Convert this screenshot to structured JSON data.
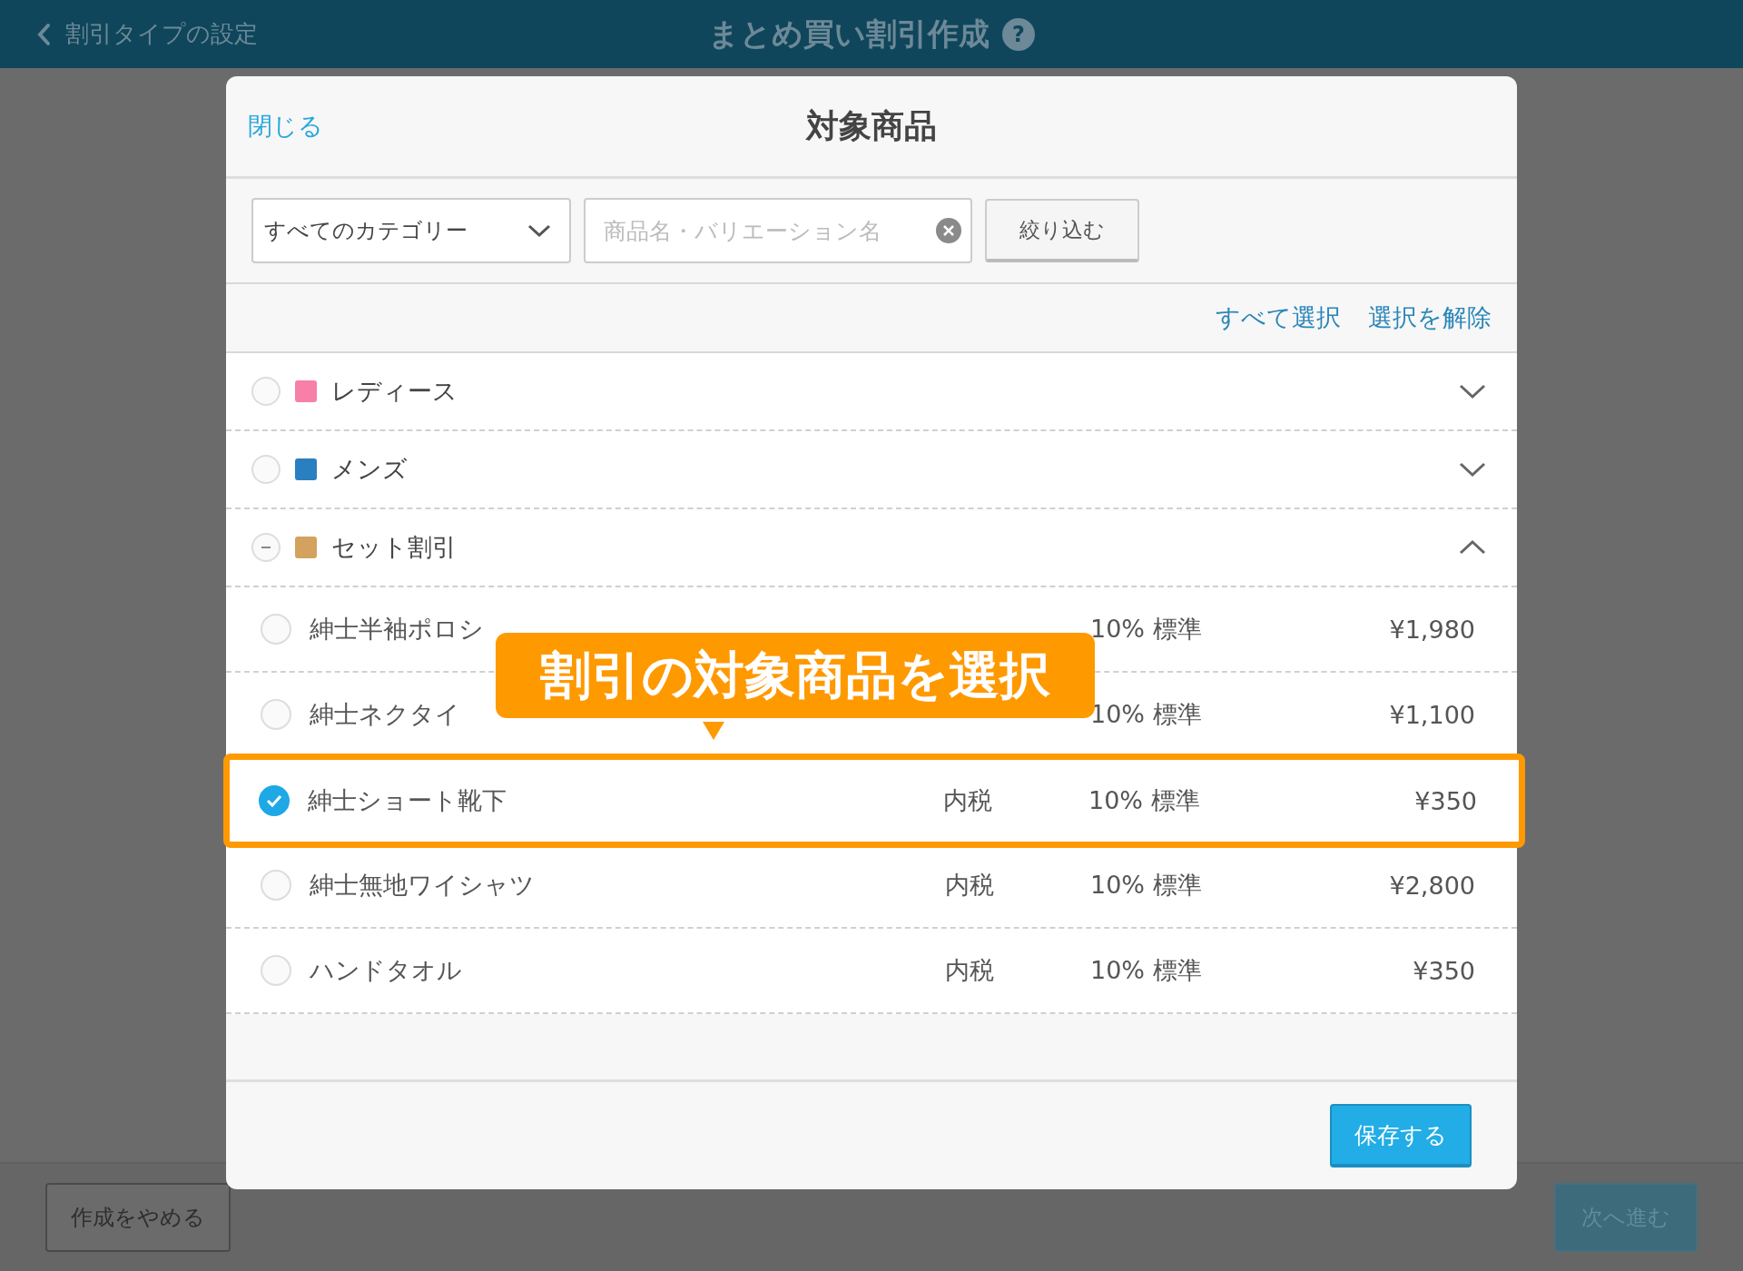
{
  "top_bar": {
    "back_label": "割引タイプの設定",
    "title": "まとめ買い割引作成",
    "help": "?"
  },
  "modal": {
    "close": "閉じる",
    "title": "対象商品",
    "filter": {
      "category": "すべてのカテゴリー",
      "search_placeholder": "商品名・バリエーション名",
      "apply": "絞り込む"
    },
    "select_all": "すべて選択",
    "deselect_all": "選択を解除",
    "categories": [
      {
        "name": "レディース",
        "color": "#f77fa8",
        "partial": false,
        "expanded": false
      },
      {
        "name": "メンズ",
        "color": "#2a7fc0",
        "partial": false,
        "expanded": false
      },
      {
        "name": "セット割引",
        "color": "#d4a25f",
        "partial": true,
        "expanded": true,
        "products": [
          {
            "name": "紳士半袖ポロシ",
            "rate": "10% 標準",
            "price": "¥1,980",
            "selected": false,
            "highlighted": false
          },
          {
            "name": "紳士ネクタイ",
            "rate": "10% 標準",
            "price": "¥1,100",
            "selected": false,
            "highlighted": false
          },
          {
            "name": "紳士ショート靴下",
            "tax": "内税",
            "rate": "10% 標準",
            "price": "¥350",
            "selected": true,
            "highlighted": true
          },
          {
            "name": "紳士無地ワイシャツ",
            "tax": "内税",
            "rate": "10% 標準",
            "price": "¥2,800",
            "selected": false,
            "highlighted": false
          },
          {
            "name": "ハンドタオル",
            "tax": "内税",
            "rate": "10% 標準",
            "price": "¥350",
            "selected": false,
            "highlighted": false
          }
        ]
      }
    ],
    "save": "保存する"
  },
  "callout": {
    "text": "割引の対象商品を選択"
  },
  "bottom_bar": {
    "cancel": "作成をやめる",
    "next": "次へ進む"
  }
}
